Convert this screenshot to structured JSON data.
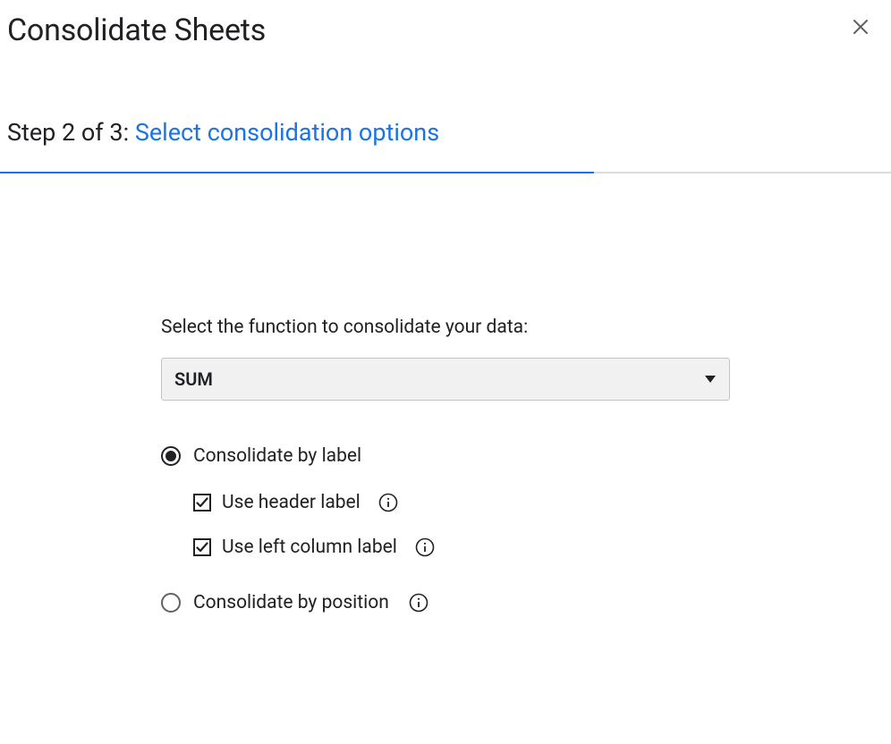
{
  "header": {
    "title": "Consolidate Sheets"
  },
  "step": {
    "prefix": "Step 2 of 3: ",
    "title": "Select consolidation options"
  },
  "form": {
    "function_label": "Select the function to consolidate your data:",
    "function_selected": "SUM",
    "radio_label_by_label": "Consolidate by label",
    "checkbox_header": "Use header label",
    "checkbox_left_column": "Use left column label",
    "radio_label_by_position": "Consolidate by position"
  }
}
